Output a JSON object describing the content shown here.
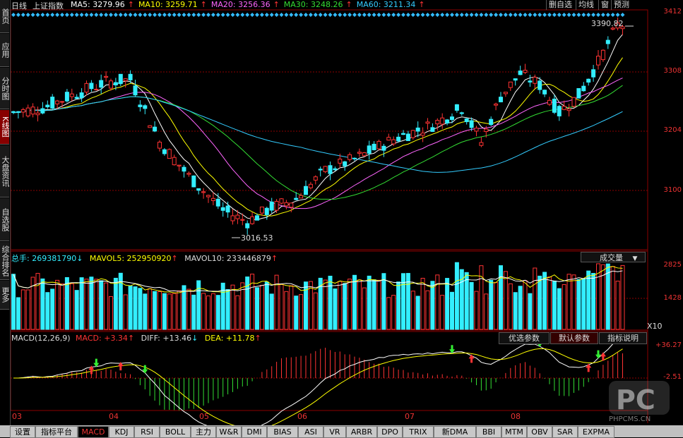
{
  "header": {
    "period": "日线",
    "index_name": "上证指数",
    "ma": [
      {
        "label": "MA5: 3279.96",
        "color": "#ffffff"
      },
      {
        "label": "MA10: 3259.71",
        "color": "#ffff00"
      },
      {
        "label": "MA20: 3256.36",
        "color": "#ff66ff"
      },
      {
        "label": "MA30: 3248.26",
        "color": "#33dd33"
      },
      {
        "label": "MA60: 3211.34",
        "color": "#33ccff"
      }
    ],
    "buttons": [
      "删自选",
      "均线",
      "窗",
      "预测"
    ]
  },
  "sidebar": {
    "tabs": [
      "首页",
      "应用",
      "分时图",
      "K线图",
      "大盘资讯",
      "自选股",
      "综合排名",
      "更多"
    ],
    "active": "K线图"
  },
  "price_axis": {
    "labels": [
      "3412",
      "3308",
      "3204",
      "3100"
    ],
    "high_marker": "3390.82",
    "low_marker": "3016.53"
  },
  "volume": {
    "total_label": "总手: 269381790",
    "mavol5_label": "MAVOL5: 252950920",
    "mavol10_label": "MAVOL10: 233446879",
    "selector": "成交量",
    "axis_labels": [
      "2825",
      "1428"
    ],
    "unit": "X10"
  },
  "macd": {
    "title": "MACD(12,26,9)",
    "macd_label": "MACD: +3.34",
    "diff_label": "DIFF: +13.46",
    "dea_label": "DEA: +11.78",
    "buttons": [
      "优选参数",
      "默认参数",
      "指标说明"
    ],
    "axis_labels": [
      "+36.27",
      "-2.51"
    ]
  },
  "x_axis": {
    "labels": [
      "03",
      "04",
      "05",
      "06",
      "07",
      "08"
    ]
  },
  "bottom_tabs": [
    "设置",
    "指标平台",
    "MACD",
    "KDJ",
    "RSI",
    "BOLL",
    "主力",
    "W&R",
    "DMI",
    "BIAS",
    "ASI",
    "VR",
    "ARBR",
    "DPO",
    "TRIX",
    "新DMA",
    "BBI",
    "MTM",
    "OBV",
    "SAR",
    "EXPMA"
  ],
  "active_bottom_tab": "MACD",
  "watermark": "PHPCMS.CN",
  "colors": {
    "up": "#ff3333",
    "down": "#33eeff",
    "grid": "#8b0000",
    "background": "#000000"
  }
}
